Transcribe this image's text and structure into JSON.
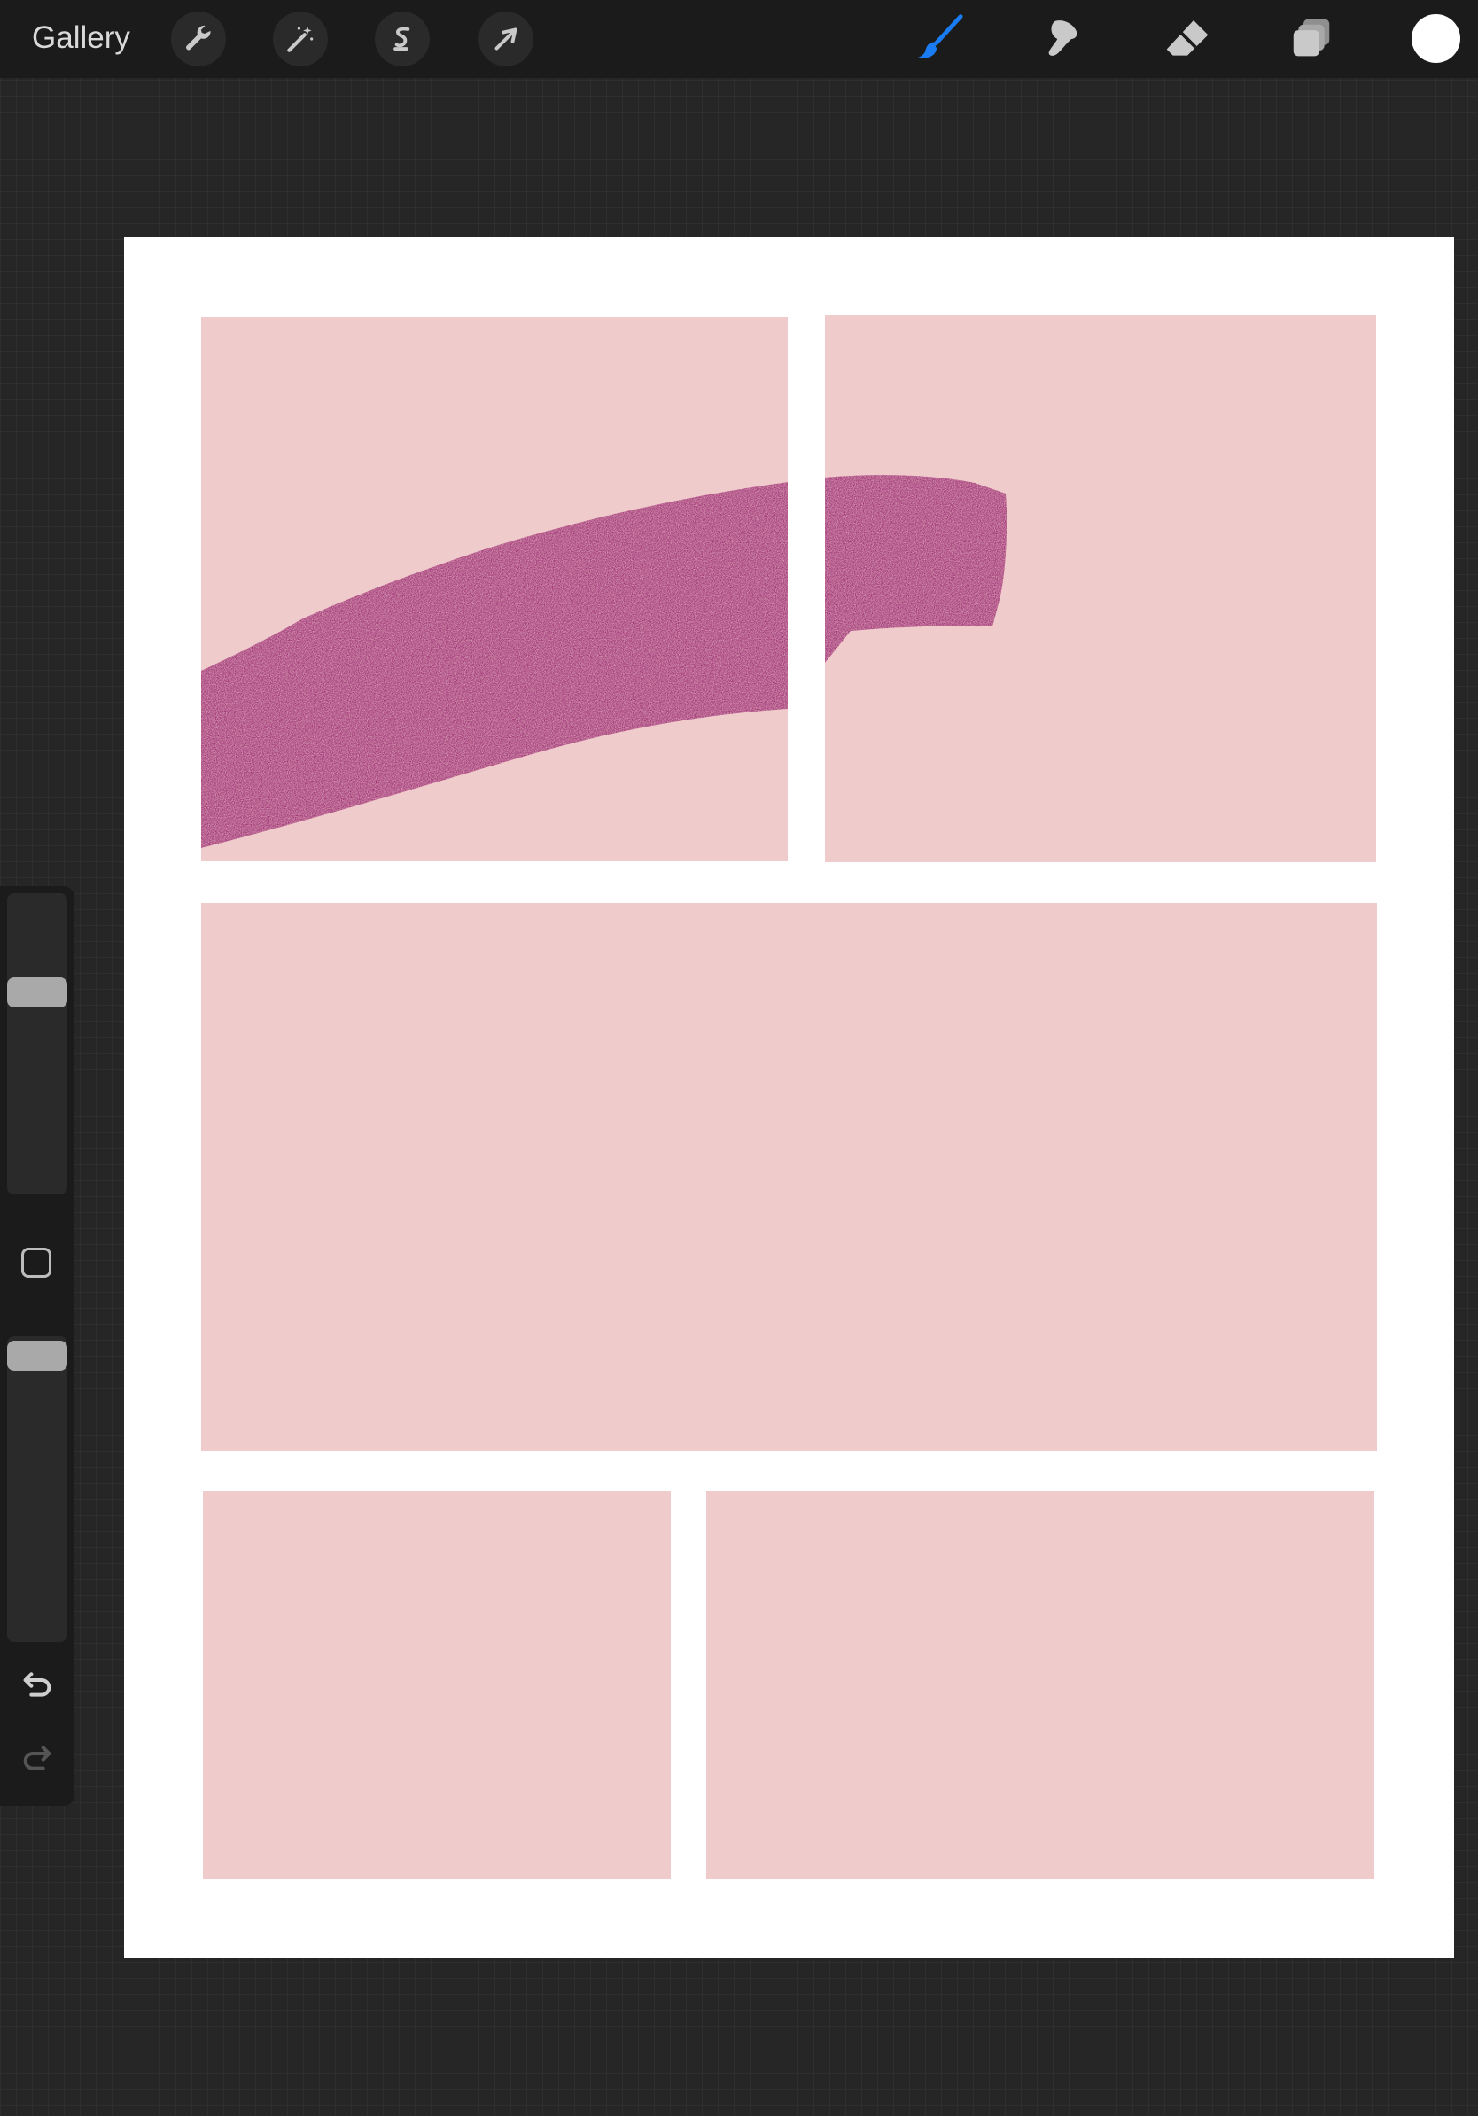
{
  "toolbar": {
    "gallery_label": "Gallery",
    "left_tools": [
      {
        "icon": "wrench-icon",
        "name": "actions"
      },
      {
        "icon": "magic-wand-icon",
        "name": "adjustments"
      },
      {
        "icon": "selection-s-icon",
        "name": "selection"
      },
      {
        "icon": "arrow-cursor-icon",
        "name": "transform"
      }
    ],
    "right_tools": [
      {
        "icon": "brush-icon",
        "name": "paint",
        "active": true
      },
      {
        "icon": "smudge-finger-icon",
        "name": "smudge"
      },
      {
        "icon": "eraser-icon",
        "name": "erase"
      },
      {
        "icon": "layers-icon",
        "name": "layers"
      }
    ],
    "current_color": "#ffffff",
    "active_color": "#1a7cf5"
  },
  "sidebar": {
    "brush_size_level": 0.33,
    "opacity_level": 0.0,
    "undo_icon": "undo-arrow-icon",
    "redo_icon": "redo-arrow-icon",
    "modify_icon": "square-modify-icon"
  },
  "canvas": {
    "background_color": "#ffffff",
    "panel_color": "#f0cbcb",
    "stroke_color": "#951f6c",
    "panel_count": 5
  }
}
